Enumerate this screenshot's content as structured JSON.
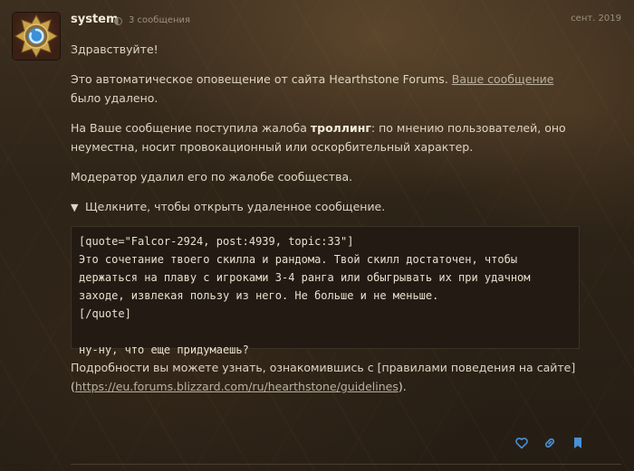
{
  "post": {
    "username": "system",
    "post_count": "3 сообщения",
    "date": "сент. 2019",
    "greeting": "Здравствуйте!",
    "para1": {
      "before": "Это автоматическое оповещение от сайта Hearthstone Forums. ",
      "link": "Ваше сообщение",
      "after": " было удалено."
    },
    "para2": {
      "before": "На Ваше сообщение поступила жалоба ",
      "bold": "троллинг",
      "after": ": по мнению пользователей, оно неуместна, носит провокационный или оскорбительный характер."
    },
    "para3": "Модератор удалил его по жалобе сообщества.",
    "details": {
      "toggle_icon": "▼",
      "summary": "Щелкните, чтобы открыть удаленное сообщение."
    },
    "code": "[quote=\"Falcor-2924, post:4939, topic:33\"]\nЭто сочетание твоего скилла и рандома. Твой скилл достаточен, чтобы держаться на плаву с игроками 3-4 ранга или обыгрывать их при удачном заходе, извлекая пользу из него. Не больше и не меньше.\n[/quote]\n\nну-ну, что еще придумаешь?",
    "footer": {
      "before": "Подробности вы можете узнать, ознакомившись с [правилами поведения на сайте] (",
      "link": "https://eu.forums.blizzard.com/ru/hearthstone/guidelines",
      "after": ")."
    }
  },
  "icons": {
    "like": "heart-icon",
    "share": "link-icon",
    "bookmark": "bookmark-icon"
  },
  "colors": {
    "accent": "#4a8fd8",
    "text": "#ded6c4",
    "background": "#2e2418"
  }
}
